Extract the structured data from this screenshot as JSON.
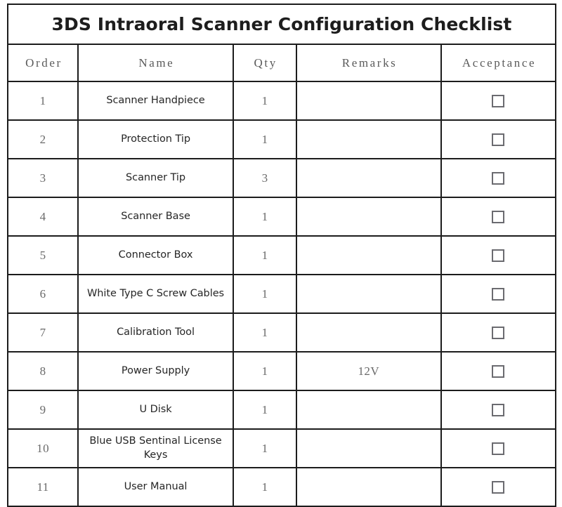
{
  "document": {
    "title": "3DS Intraoral Scanner Configuration Checklist"
  },
  "table": {
    "columns": [
      {
        "key": "order",
        "label": "Order"
      },
      {
        "key": "name",
        "label": "Name"
      },
      {
        "key": "qty",
        "label": "Qty"
      },
      {
        "key": "remarks",
        "label": "Remarks"
      },
      {
        "key": "acceptance",
        "label": "Acceptance"
      }
    ],
    "rows": [
      {
        "order": "1",
        "name": "Scanner Handpiece",
        "qty": "1",
        "remarks": "",
        "acceptance": "checkbox-unchecked"
      },
      {
        "order": "2",
        "name": "Protection Tip",
        "qty": "1",
        "remarks": "",
        "acceptance": "checkbox-unchecked"
      },
      {
        "order": "3",
        "name": "Scanner Tip",
        "qty": "3",
        "remarks": "",
        "acceptance": "checkbox-unchecked"
      },
      {
        "order": "4",
        "name": "Scanner Base",
        "qty": "1",
        "remarks": "",
        "acceptance": "checkbox-unchecked"
      },
      {
        "order": "5",
        "name": "Connector Box",
        "qty": "1",
        "remarks": "",
        "acceptance": "checkbox-unchecked"
      },
      {
        "order": "6",
        "name": "White Type C Screw Cables",
        "qty": "1",
        "remarks": "",
        "acceptance": "checkbox-unchecked"
      },
      {
        "order": "7",
        "name": "Calibration Tool",
        "qty": "1",
        "remarks": "",
        "acceptance": "checkbox-unchecked"
      },
      {
        "order": "8",
        "name": "Power Supply",
        "qty": "1",
        "remarks": "12V",
        "acceptance": "checkbox-unchecked"
      },
      {
        "order": "9",
        "name": "U Disk",
        "qty": "1",
        "remarks": "",
        "acceptance": "checkbox-unchecked"
      },
      {
        "order": "10",
        "name": "Blue USB Sentinal License Keys",
        "qty": "1",
        "remarks": "",
        "acceptance": "checkbox-unchecked"
      },
      {
        "order": "11",
        "name": "User Manual",
        "qty": "1",
        "remarks": "",
        "acceptance": "checkbox-unchecked"
      }
    ]
  },
  "style": {
    "page_background": "#ffffff",
    "border_color": "#1c1c1c",
    "title_color": "#1d1d1d",
    "header_text_color": "#5a5a5a",
    "body_text_color": "#262626",
    "number_text_color": "#6a6a6a",
    "checkbox_border_color": "#6b6b70"
  }
}
